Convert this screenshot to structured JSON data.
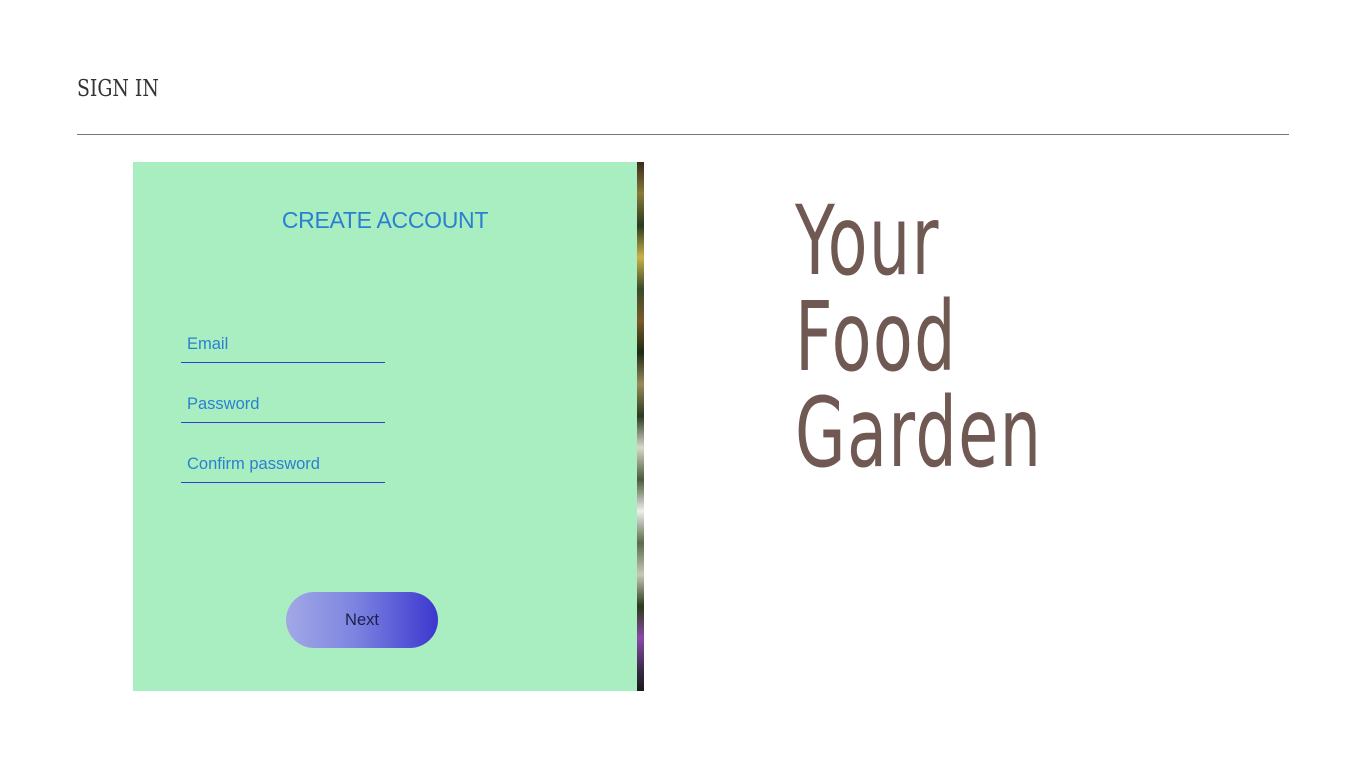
{
  "header": {
    "title": "SIGN IN"
  },
  "form": {
    "title": "CREATE ACCOUNT",
    "email_placeholder": "Email",
    "password_placeholder": "Password",
    "confirm_placeholder": "Confirm password",
    "next_label": "Next"
  },
  "hero": {
    "line1": "Your",
    "line2": "Food",
    "line3": "Garden"
  },
  "colors": {
    "card_background": "#a9eec1",
    "accent_blue": "#2b7fd1",
    "field_underline": "#2f3fd0",
    "hero_text": "#6f5952"
  }
}
